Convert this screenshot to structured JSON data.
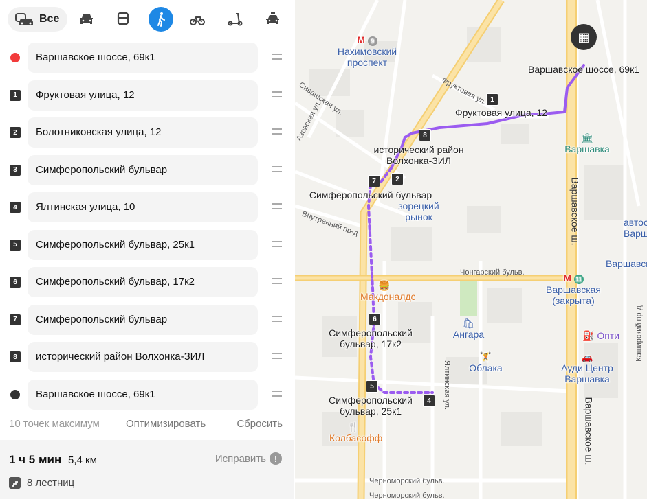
{
  "modes": {
    "all_label": "Все",
    "items": [
      "car-icon",
      "bus-icon",
      "pedestrian-icon",
      "bicycle-icon",
      "scooter-icon",
      "taxi-icon"
    ],
    "active": "pedestrian-icon",
    "accent": "#1e88e5"
  },
  "waypoints": [
    {
      "marker": "start",
      "label": "Варшавское шоссе, 69к1"
    },
    {
      "marker": "1",
      "label": "Фруктовая улица, 12"
    },
    {
      "marker": "2",
      "label": "Болотниковская улица, 12"
    },
    {
      "marker": "3",
      "label": "Симферопольский бульвар"
    },
    {
      "marker": "4",
      "label": "Ялтинская улица, 10"
    },
    {
      "marker": "5",
      "label": "Симферопольский бульвар, 25к1"
    },
    {
      "marker": "6",
      "label": "Симферопольский бульвар, 17к2"
    },
    {
      "marker": "7",
      "label": "Симферопольский бульвар"
    },
    {
      "marker": "8",
      "label": "исторический район Волхонка-ЗИЛ"
    },
    {
      "marker": "end",
      "label": "Варшавское шоссе, 69к1"
    }
  ],
  "actions": {
    "limit": "10 точек максимум",
    "optimize": "Оптимизировать",
    "reset": "Сбросить"
  },
  "summary": {
    "duration": "1 ч 5 мин",
    "distance": "5,4 км",
    "fix": "Исправить",
    "stairs": "8 лестниц"
  },
  "map": {
    "route_color": "#9b5cf0",
    "metro": [
      {
        "name": "Нахимовский проспект",
        "line": "9"
      },
      {
        "name": "Варшавская (закрыта)",
        "line": "11"
      }
    ],
    "pins": [
      {
        "n": "1",
        "label": "Фруктовая улица, 12"
      },
      {
        "n": "8",
        "label": "исторический район Волхонка-ЗИЛ"
      },
      {
        "n": "2",
        "label": ""
      },
      {
        "n": "7",
        "label": "Симферопольский бульвар"
      },
      {
        "n": "6",
        "label": "Симферопольский бульвар, 17к2"
      },
      {
        "n": "5",
        "label": "Симферопольский бульвар, 25к1"
      },
      {
        "n": "4",
        "label": ""
      }
    ],
    "destination": "Варшавское шоссе, 69к1",
    "pois": [
      "Варшавка",
      "Варшавская",
      "автос Варш",
      "Опти",
      "Ауди Центр Варшавка",
      "Ангара",
      "Облака",
      "Макдоналдс",
      "Колбасофф",
      "зорецкий рынок"
    ],
    "streets": [
      "Сивашская ул.",
      "Азовская ул.",
      "Фруктовая ул.",
      "Внутренний пр-д",
      "Чонгарский бульв.",
      "Варшавское ш.",
      "Ялтинская ул.",
      "Каширский пр-д",
      "Черноморский бульв.",
      "Черноморский бульв."
    ]
  }
}
